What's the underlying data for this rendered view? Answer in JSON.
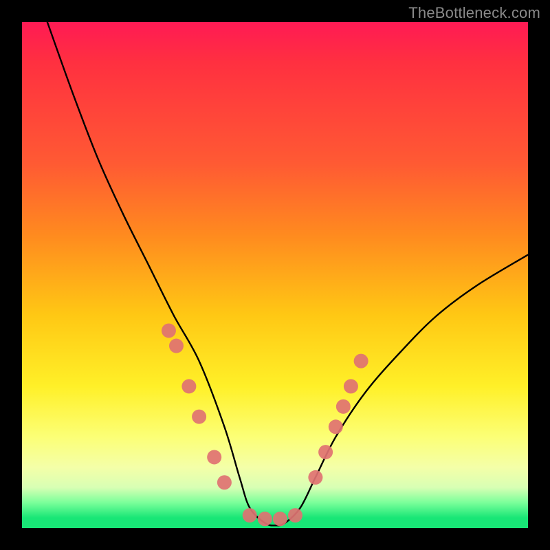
{
  "watermark": {
    "text": "TheBottleneck.com"
  },
  "chart_data": {
    "type": "line",
    "title": "",
    "xlabel": "",
    "ylabel": "",
    "ylim": [
      0,
      100
    ],
    "xlim": [
      0,
      100
    ],
    "series": [
      {
        "name": "bottleneck-curve",
        "x": [
          5,
          10,
          15,
          20,
          25,
          30,
          35,
          40,
          43,
          45,
          48,
          50,
          52,
          55,
          58,
          62,
          68,
          75,
          82,
          90,
          100
        ],
        "y": [
          100,
          86,
          73,
          62,
          52,
          42,
          33,
          20,
          10,
          4,
          1,
          0.5,
          1,
          4,
          10,
          18,
          27,
          35,
          42,
          48,
          54
        ]
      }
    ],
    "markers": {
      "name": "highlight-dots",
      "color": "#e07272",
      "points": [
        {
          "x": 29,
          "y": 39
        },
        {
          "x": 30.5,
          "y": 36
        },
        {
          "x": 33,
          "y": 28
        },
        {
          "x": 35,
          "y": 22
        },
        {
          "x": 38,
          "y": 14
        },
        {
          "x": 40,
          "y": 9
        },
        {
          "x": 45,
          "y": 2.5
        },
        {
          "x": 48,
          "y": 1.8
        },
        {
          "x": 51,
          "y": 1.8
        },
        {
          "x": 54,
          "y": 2.5
        },
        {
          "x": 58,
          "y": 10
        },
        {
          "x": 60,
          "y": 15
        },
        {
          "x": 62,
          "y": 20
        },
        {
          "x": 63.5,
          "y": 24
        },
        {
          "x": 65,
          "y": 28
        },
        {
          "x": 67,
          "y": 33
        }
      ]
    },
    "gradient_stops": [
      {
        "pos": 0,
        "color": "#ff1a54"
      },
      {
        "pos": 28,
        "color": "#ff5a33"
      },
      {
        "pos": 58,
        "color": "#ffc814"
      },
      {
        "pos": 82,
        "color": "#fcff76"
      },
      {
        "pos": 95,
        "color": "#7aff9a"
      },
      {
        "pos": 100,
        "color": "#18e676"
      }
    ]
  }
}
